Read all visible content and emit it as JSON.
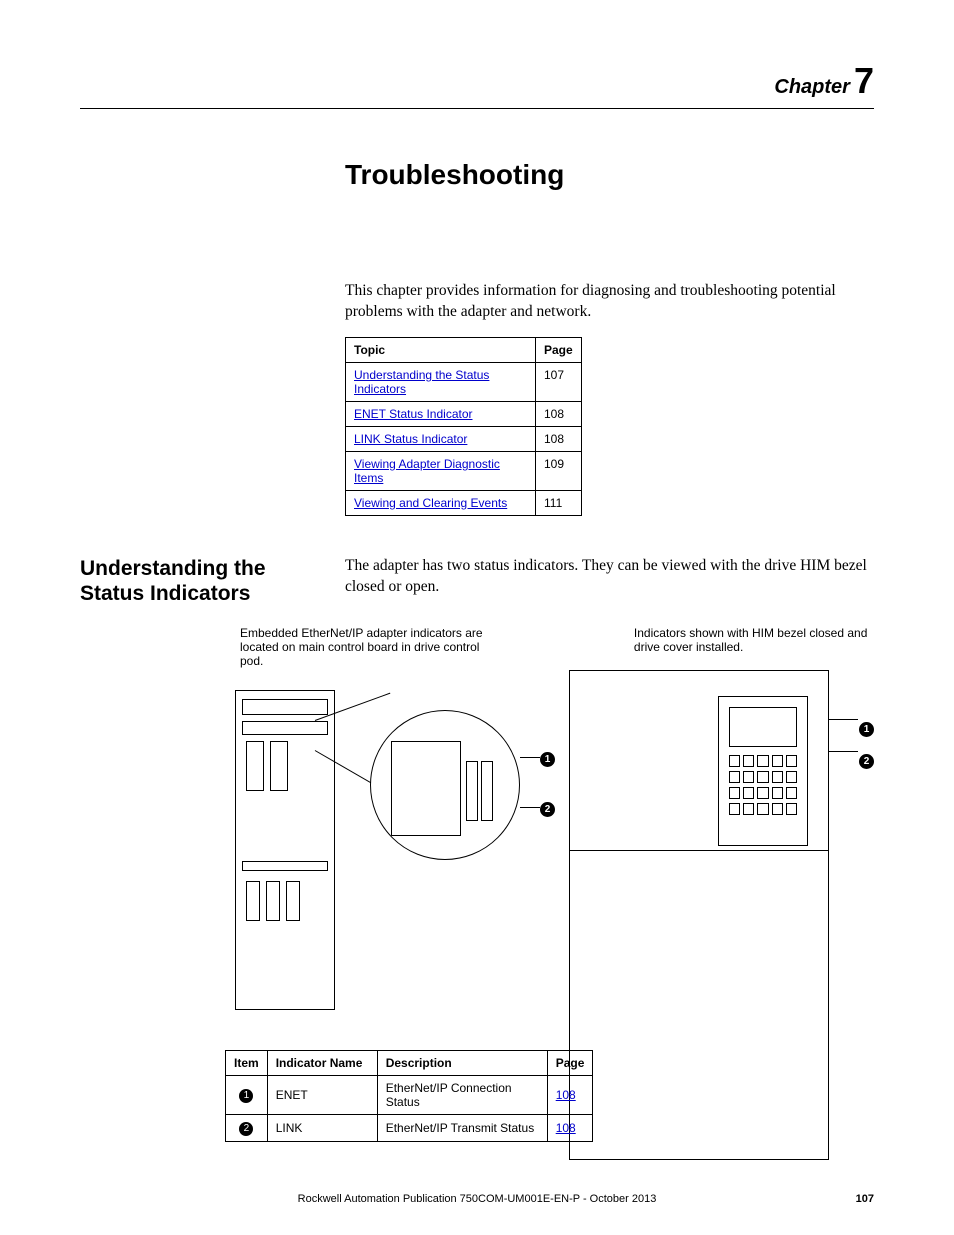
{
  "chapter": {
    "label": "Chapter",
    "number": "7"
  },
  "title": "Troubleshooting",
  "intro": "This chapter provides information for diagnosing and troubleshooting potential problems with the adapter and network.",
  "topic_table": {
    "headers": {
      "topic": "Topic",
      "page": "Page"
    },
    "rows": [
      {
        "topic": "Understanding the Status Indicators",
        "page": "107"
      },
      {
        "topic": "ENET Status Indicator",
        "page": "108"
      },
      {
        "topic": "LINK Status Indicator",
        "page": "108"
      },
      {
        "topic": "Viewing Adapter Diagnostic Items",
        "page": "109"
      },
      {
        "topic": "Viewing and Clearing Events",
        "page": "111"
      }
    ]
  },
  "section": {
    "heading": "Understanding the Status Indicators",
    "text": "The adapter has two status indicators. They can be viewed with the drive HIM bezel closed or open."
  },
  "captions": {
    "left": "Embedded EtherNet/IP adapter indicators are located on main control board in drive control pod.",
    "right": "Indicators shown with HIM bezel closed and drive cover installed."
  },
  "callouts": {
    "one": "1",
    "two": "2"
  },
  "indicator_table": {
    "headers": {
      "item": "Item",
      "name": "Indicator Name",
      "desc": "Description",
      "page": "Page"
    },
    "rows": [
      {
        "item": "1",
        "name": "ENET",
        "desc": "EtherNet/IP Connection Status",
        "page": "108"
      },
      {
        "item": "2",
        "name": "LINK",
        "desc": "EtherNet/IP Transmit Status",
        "page": "108"
      }
    ]
  },
  "footer": {
    "text": "Rockwell Automation Publication 750COM-UM001E-EN-P - October 2013",
    "page": "107"
  }
}
